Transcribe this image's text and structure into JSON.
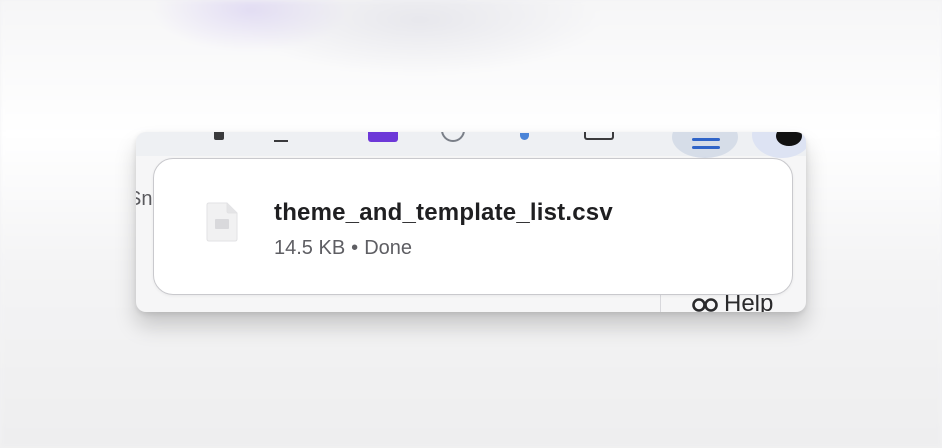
{
  "download": {
    "file_name": "theme_and_template_list.csv",
    "file_size": "14.5 KB",
    "separator": "•",
    "status": "Done",
    "file_icon": "document-file-icon"
  },
  "background": {
    "left_edge_text": "Sn",
    "help_label": "Help",
    "help_icon": "infinity-loop-icon"
  },
  "colors": {
    "accent_blue": "#2f64c8",
    "extension_purple": "#6d38d8",
    "popup_border": "#c9c9cd"
  }
}
